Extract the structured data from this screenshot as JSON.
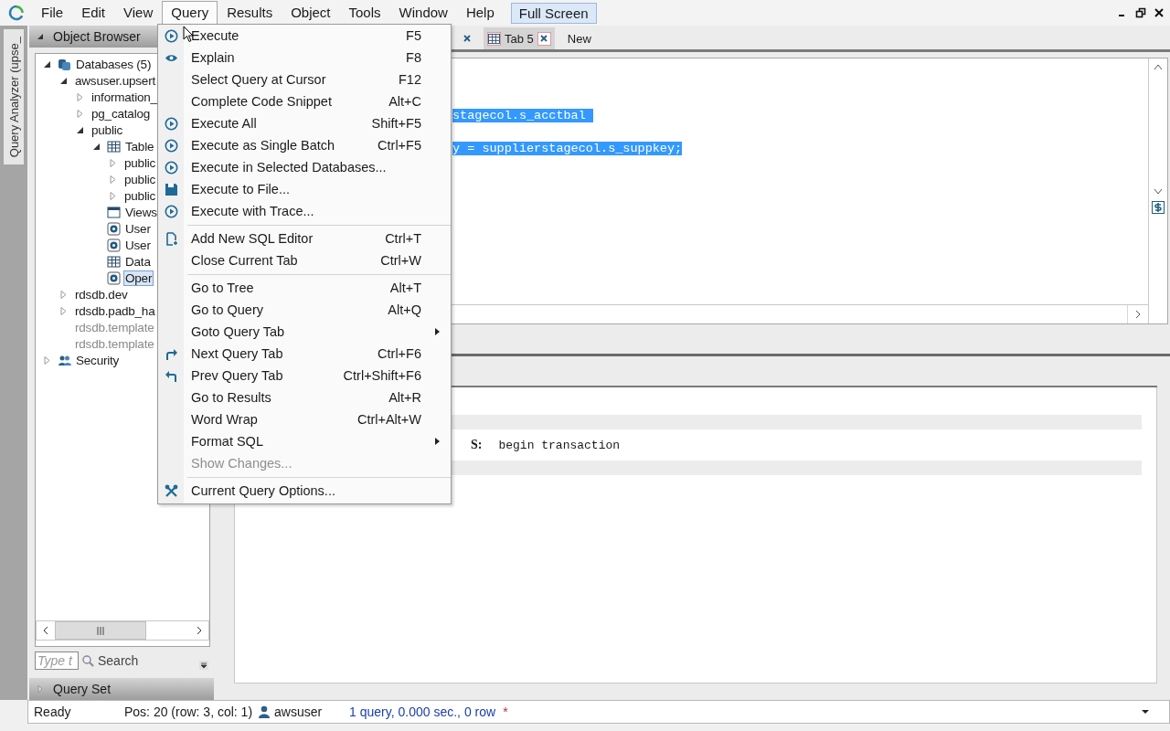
{
  "menu_bar": {
    "items": [
      {
        "label": "File",
        "selected": false
      },
      {
        "label": "Edit",
        "selected": false
      },
      {
        "label": "View",
        "selected": false
      },
      {
        "label": "Query",
        "selected": true
      },
      {
        "label": "Results",
        "selected": false
      },
      {
        "label": "Object",
        "selected": false
      },
      {
        "label": "Tools",
        "selected": false
      },
      {
        "label": "Window",
        "selected": false
      },
      {
        "label": "Help",
        "selected": false
      }
    ],
    "full_screen": {
      "label": "Full Screen",
      "on": true
    }
  },
  "side_tab": {
    "label": "Query Analyzer (upse_"
  },
  "object_browser": {
    "title": "Object Browser",
    "tree": [
      {
        "label": "Databases (5)",
        "kind": "databases",
        "expanded": true,
        "selected": false,
        "disabled": false,
        "children": [
          {
            "label": "awsuser.upsert",
            "expanded": true,
            "selected": false,
            "disabled": false,
            "children": [
              {
                "label": "information_",
                "expanded": false,
                "selected": false,
                "disabled": false
              },
              {
                "label": "pg_catalog",
                "expanded": false,
                "selected": false,
                "disabled": false
              },
              {
                "label": "public",
                "expanded": true,
                "selected": false,
                "disabled": false,
                "children": [
                  {
                    "label": "Table",
                    "kind": "table",
                    "expanded": true,
                    "selected": false,
                    "disabled": false,
                    "children": [
                      {
                        "label": "public",
                        "expanded": false,
                        "selected": false,
                        "disabled": false
                      },
                      {
                        "label": "public",
                        "expanded": false,
                        "selected": false,
                        "disabled": false
                      },
                      {
                        "label": "public",
                        "expanded": false,
                        "selected": false,
                        "disabled": false
                      }
                    ]
                  },
                  {
                    "label": "Views",
                    "kind": "view",
                    "selected": false,
                    "disabled": false
                  },
                  {
                    "label": "User",
                    "kind": "function",
                    "selected": false,
                    "disabled": false
                  },
                  {
                    "label": "User",
                    "kind": "function",
                    "selected": false,
                    "disabled": false
                  },
                  {
                    "label": "Data",
                    "kind": "table",
                    "selected": false,
                    "disabled": false
                  },
                  {
                    "label": "Oper",
                    "kind": "function",
                    "selected": true,
                    "disabled": false
                  }
                ]
              }
            ]
          },
          {
            "label": "rdsdb.dev",
            "expanded": false,
            "selected": false,
            "disabled": false
          },
          {
            "label": "rdsdb.padb_ha",
            "expanded": false,
            "selected": false,
            "disabled": false
          },
          {
            "label": "rdsdb.template",
            "selected": false,
            "disabled": true
          },
          {
            "label": "rdsdb.template",
            "selected": false,
            "disabled": true
          }
        ]
      },
      {
        "label": "Security",
        "kind": "users",
        "expanded": false,
        "selected": false,
        "disabled": false
      }
    ],
    "search": {
      "placeholder": "Type t",
      "button": "Search"
    },
    "query_set": {
      "title": "Query Set"
    }
  },
  "tabs": [
    {
      "selected": false
    },
    {
      "label": "Tab 5",
      "selected": true
    }
  ],
  "new_tab": "New",
  "editor": {
    "lines": [
      {
        "text": "stagecol.s_acctbal ",
        "selected": true
      },
      {
        "text": "y = supplierstagecol.s_suppkey;",
        "selected": true
      }
    ]
  },
  "results": {
    "rows": [
      {
        "label": "S:",
        "text": "begin transaction"
      }
    ]
  },
  "query_menu": [
    {
      "kind": "play",
      "label": "Execute",
      "shortcut": "F5",
      "disabled": false
    },
    {
      "kind": "eye",
      "label": "Explain",
      "shortcut": "F8",
      "disabled": false
    },
    {
      "kind": "item",
      "label": "Select Query at Cursor",
      "shortcut": "F12",
      "disabled": false
    },
    {
      "kind": "item",
      "label": "Complete Code Snippet",
      "shortcut": "Alt+C",
      "disabled": false
    },
    {
      "kind": "play",
      "label": "Execute All",
      "shortcut": "Shift+F5",
      "disabled": false
    },
    {
      "kind": "play",
      "label": "Execute as Single Batch",
      "shortcut": "Ctrl+F5",
      "disabled": false
    },
    {
      "kind": "play",
      "label": "Execute in Selected Databases...",
      "disabled": false
    },
    {
      "kind": "disk",
      "label": "Execute to File...",
      "disabled": false
    },
    {
      "kind": "play",
      "label": "Execute with Trace...",
      "disabled": false
    },
    {
      "kind": "separator"
    },
    {
      "kind": "doc",
      "label": "Add New SQL Editor",
      "shortcut": "Ctrl+T",
      "disabled": false
    },
    {
      "kind": "item",
      "label": "Close Current Tab",
      "shortcut": "Ctrl+W",
      "disabled": false
    },
    {
      "kind": "separator"
    },
    {
      "kind": "item",
      "label": "Go to Tree",
      "shortcut": "Alt+T",
      "disabled": false
    },
    {
      "kind": "item",
      "label": "Go to Query",
      "shortcut": "Alt+Q",
      "disabled": false
    },
    {
      "kind": "submenu",
      "label": "Goto Query Tab",
      "disabled": false
    },
    {
      "kind": "forward",
      "label": "Next Query Tab",
      "shortcut": "Ctrl+F6",
      "disabled": false
    },
    {
      "kind": "back",
      "label": "Prev Query Tab",
      "shortcut": "Ctrl+Shift+F6",
      "disabled": false
    },
    {
      "kind": "item",
      "label": "Go to Results",
      "shortcut": "Alt+R",
      "disabled": false
    },
    {
      "kind": "item",
      "label": "Word Wrap",
      "shortcut": "Ctrl+Alt+W",
      "disabled": false
    },
    {
      "kind": "submenu",
      "label": "Format SQL",
      "disabled": false
    },
    {
      "kind": "item",
      "label": "Show Changes...",
      "disabled": true
    },
    {
      "kind": "separator"
    },
    {
      "kind": "tools",
      "label": "Current Query Options...",
      "disabled": false
    }
  ],
  "status_bar": {
    "state": "Ready",
    "position": "Pos: 20 (row: 3, col: 1)",
    "user": "awsuser",
    "summary": "1 query, 0.000 sec., 0 row",
    "modified": "*"
  }
}
